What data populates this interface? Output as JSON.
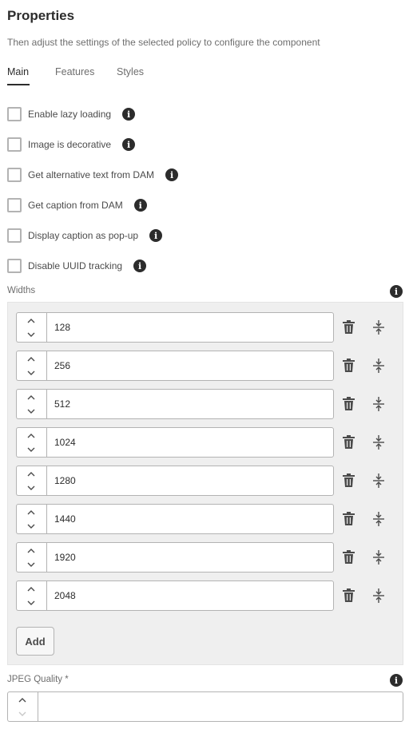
{
  "header": {
    "title": "Properties",
    "description": "Then adjust the settings of the selected policy to configure the component"
  },
  "tabs": [
    {
      "label": "Main",
      "active": true
    },
    {
      "label": "Features",
      "active": false
    },
    {
      "label": "Styles",
      "active": false
    }
  ],
  "checkboxes": [
    {
      "label": "Enable lazy loading",
      "checked": false
    },
    {
      "label": "Image is decorative",
      "checked": false
    },
    {
      "label": "Get alternative text from DAM",
      "checked": false
    },
    {
      "label": "Get caption from DAM",
      "checked": false
    },
    {
      "label": "Display caption as pop-up",
      "checked": false
    },
    {
      "label": "Disable UUID tracking",
      "checked": false
    }
  ],
  "widths": {
    "label": "Widths",
    "items": [
      "128",
      "256",
      "512",
      "1024",
      "1280",
      "1440",
      "1920",
      "2048"
    ],
    "add_label": "Add"
  },
  "jpeg_quality": {
    "label": "JPEG Quality *",
    "value": ""
  },
  "icons": {
    "info": "info-icon",
    "delete": "trash-icon",
    "reorder": "move-handle-icon",
    "increment": "chevron-up-icon",
    "decrement": "chevron-down-icon"
  },
  "colors": {
    "text_dark": "#2c2c2c",
    "text_muted": "#6e6e6e",
    "panel_bg": "#efefef",
    "border": "#b3b3b3"
  }
}
